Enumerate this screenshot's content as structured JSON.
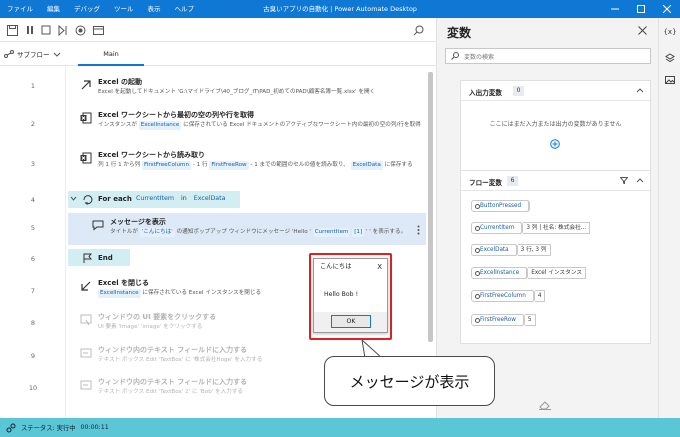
{
  "titlebar": {
    "menu": [
      "ファイル",
      "編集",
      "デバッグ",
      "ツール",
      "表示",
      "ヘルプ"
    ],
    "title": "古臭いアプリの自動化 | Power Automate Desktop"
  },
  "subflows": {
    "label": "サブフロー",
    "main_tab": "Main"
  },
  "flow": {
    "actions": [
      {
        "line": "1",
        "title": "Excel の起動",
        "desc": [
          {
            "t": "Excel を起動してドキュメント 'G:\\マイドライブ\\40_ブログ_IT\\PAD_初めてのPAD\\顧客名簿一覧.xlsx' を開く"
          }
        ]
      },
      {
        "line": "2",
        "title": "Excel ワークシートから最初の空の列や行を取得",
        "desc": [
          {
            "t": "インスタンスが "
          },
          {
            "c": "ExcelInstance"
          },
          {
            "t": " に保存されている Excel ドキュメントのアクティブなワークシート内の最初の空の列/行を取得"
          }
        ]
      },
      {
        "line": "3",
        "title": "Excel ワークシートから読み取り",
        "desc": [
          {
            "t": "列 1 行 1 から列 "
          },
          {
            "c": "FirstFreeColumn"
          },
          {
            "t": " - 1 行 "
          },
          {
            "c": "FirstFreeRow"
          },
          {
            "t": " - 1 までの範囲のセルの値を読み取り、 "
          },
          {
            "c": "ExcelData"
          },
          {
            "t": " に保存する"
          }
        ]
      },
      {
        "line": "4",
        "title": "For each",
        "header_chips": [
          "CurrentItem",
          "in",
          "ExcelData"
        ]
      },
      {
        "line": "5",
        "title": "メッセージを表示",
        "desc": [
          {
            "t": "タイトルが "
          },
          {
            "c": "'こんにちは'"
          },
          {
            "t": " の通知ポップアップ ウィンドウにメッセージ 'Hello ' "
          },
          {
            "c": "CurrentItem"
          },
          {
            "t": " "
          },
          {
            "c": "[1]"
          },
          {
            "t": " ' ' を表示する。"
          }
        ]
      },
      {
        "line": "6",
        "title": "End"
      },
      {
        "line": "7",
        "title": "Excel を閉じる",
        "desc": [
          {
            "c": "ExcelInstance"
          },
          {
            "t": " に保存されている Excel インスタンスを閉じる"
          }
        ]
      },
      {
        "line": "8",
        "title": "ウィンドウの UI 要素をクリックする",
        "desc": [
          {
            "t": "UI 要素 'Image' 'image' をクリックする"
          }
        ]
      },
      {
        "line": "9",
        "title": "ウィンドウ内のテキスト フィールドに入力する",
        "desc": [
          {
            "t": "テキスト ボックス Edit 'TextBox' に '株式会社Hoge' を入力する"
          }
        ]
      },
      {
        "line": "10",
        "title": "ウィンドウ内のテキスト フィールドに入力する",
        "desc": [
          {
            "t": "テキスト ボックス Edit 'TextBox' 2' に 'Bob' を入力する"
          }
        ]
      }
    ]
  },
  "status": {
    "label": "ステータス: 実行中",
    "time": "00:00:11"
  },
  "variables": {
    "title": "変数",
    "search_placeholder": "変数の検索",
    "io": {
      "label": "入出力変数",
      "count": "0",
      "empty_text": "ここにはまだ入力または出力の変数がありません"
    },
    "flow_vars": {
      "label": "フロー変数",
      "count": "6",
      "items": [
        {
          "name": "ButtonPressed",
          "value": ""
        },
        {
          "name": "CurrentItem",
          "value": "3 列 | 社名: 株式会社..."
        },
        {
          "name": "ExcelData",
          "value": "3 行, 3 列"
        },
        {
          "name": "ExcelInstance",
          "value": "Excel インスタンス"
        },
        {
          "name": "FirstFreeColumn",
          "value": "4"
        },
        {
          "name": "FirstFreeRow",
          "value": "5"
        }
      ]
    }
  },
  "popup": {
    "title": "こんにちは",
    "message": "Hello Bob !",
    "ok": "OK",
    "close": "X"
  },
  "annotation": {
    "text": "メッセージが表示"
  },
  "colors": {
    "accent": "#0f78d4",
    "highlight": "#e12020",
    "status_bar": "#5bc7d6"
  }
}
